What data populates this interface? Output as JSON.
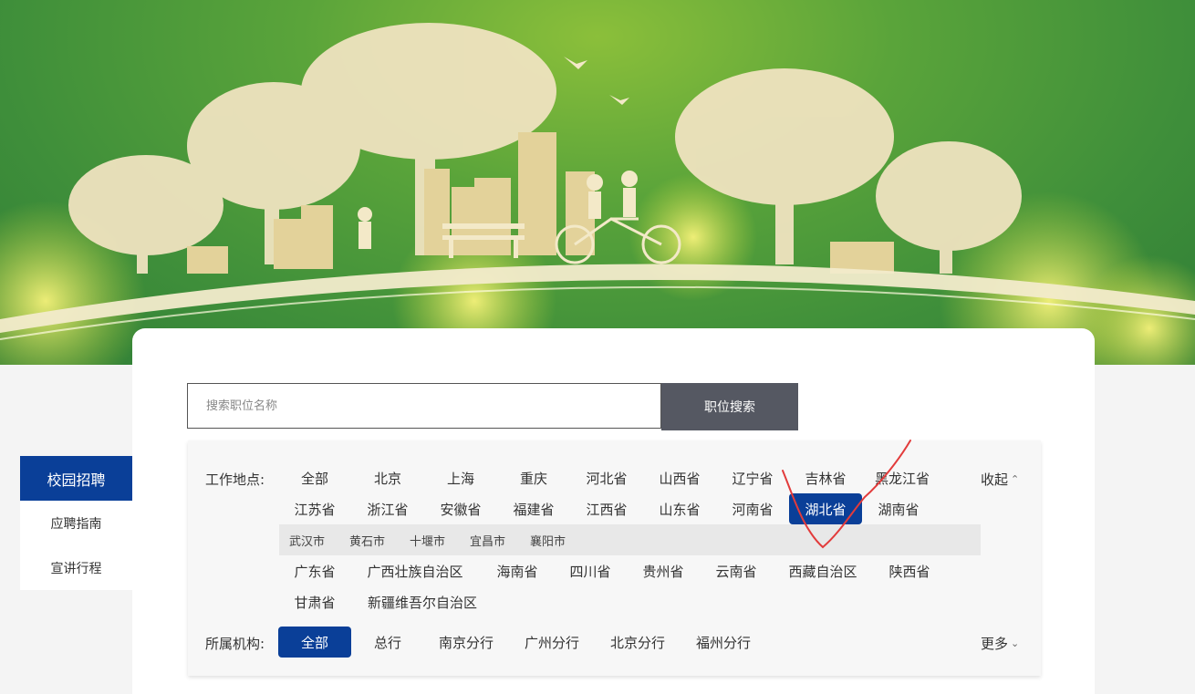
{
  "search": {
    "placeholder": "搜索职位名称",
    "button": "职位搜索"
  },
  "sidebar": {
    "active": "校园招聘",
    "items": [
      "应聘指南",
      "宣讲行程"
    ]
  },
  "filters": {
    "location_label": "工作地点:",
    "provinces_row1": [
      "全部",
      "北京",
      "上海",
      "重庆",
      "河北省",
      "山西省",
      "辽宁省",
      "吉林省",
      "黑龙江省"
    ],
    "provinces_row2": [
      "江苏省",
      "浙江省",
      "安徽省",
      "福建省",
      "江西省",
      "山东省",
      "河南省",
      "湖北省",
      "湖南省"
    ],
    "cities": [
      "武汉市",
      "黄石市",
      "十堰市",
      "宜昌市",
      "襄阳市"
    ],
    "provinces_row3": [
      "广东省",
      "广西壮族自治区",
      "海南省",
      "四川省",
      "贵州省",
      "云南省",
      "西藏自治区",
      "陕西省"
    ],
    "provinces_row4": [
      "甘肃省",
      "新疆维吾尔自治区"
    ],
    "selected_province": "湖北省",
    "collapse": "收起",
    "org_label": "所属机构:",
    "orgs": [
      "全部",
      "总行",
      "南京分行",
      "广州分行",
      "北京分行",
      "福州分行"
    ],
    "selected_org": "全部",
    "more": "更多"
  },
  "colors": {
    "primary": "#0a3f98",
    "search_button": "#555862",
    "annotation": "#e23b3b"
  },
  "icons": {
    "collapse": "chevron-up-icon",
    "more": "chevron-down-icon"
  }
}
